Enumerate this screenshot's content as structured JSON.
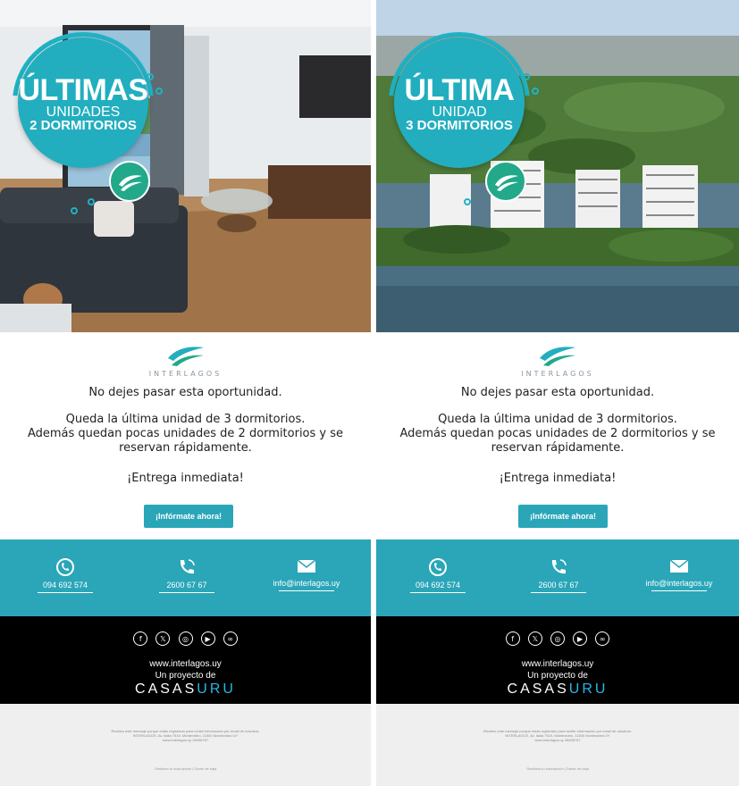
{
  "colors": {
    "teal": "#2aa6b8",
    "badge_teal": "#22aebf",
    "logo_green": "#21a98a",
    "dark_footer": "#000000",
    "legal_bg": "#efefef",
    "brand_blue": "#29b7e6"
  },
  "emails": [
    {
      "badge": {
        "line1": "ÚLTIMAS",
        "line2": "UNIDADES",
        "line3": "2 DORMITORIOS"
      },
      "brand_name": "INTERLAGOS",
      "headline": "No dejes pasar esta oportunidad.",
      "body_line1": "Queda la última unidad de 3 dormitorios.",
      "body_line2": "Además quedan pocas unidades de 2 dormitorios y se",
      "body_line3": "reservan rápidamente.",
      "delivery": "¡Entrega inmediata!",
      "cta_label": "¡Infórmate ahora!",
      "contact": {
        "whatsapp": {
          "icon": "whatsapp-icon",
          "label": "094 692 574"
        },
        "phone": {
          "icon": "phone-icon",
          "label": "2600 67 67"
        },
        "email": {
          "icon": "mail-icon",
          "label": "info@interlagos.uy"
        }
      },
      "socials": [
        {
          "icon": "facebook-icon",
          "glyph": "f"
        },
        {
          "icon": "x-icon",
          "glyph": "𝕏"
        },
        {
          "icon": "instagram-icon",
          "glyph": "◎"
        },
        {
          "icon": "youtube-icon",
          "glyph": "▶"
        },
        {
          "icon": "link-icon",
          "glyph": "∞"
        }
      ],
      "website": "www.interlagos.uy",
      "project_of": "Un proyecto de",
      "casas_left": "CASAS",
      "casas_right": "URU",
      "legal": {
        "line1": "Recibes este mensaje porque estás registrado para recibir información por email de nosotros.",
        "line2": "INTERLAGOS, Av. Italia 7519, Montevideo, 11500 Montevideo UY",
        "line3": "www.interlagos.uy 26006767",
        "links": "Gestiona tu suscripción  |  Darse de baja"
      }
    },
    {
      "badge": {
        "line1": "ÚLTIMA",
        "line2": "UNIDAD",
        "line3": "3 DORMITORIOS"
      },
      "brand_name": "INTERLAGOS",
      "headline": "No dejes pasar esta oportunidad.",
      "body_line1": "Queda la última unidad de 3 dormitorios.",
      "body_line2": "Además quedan pocas unidades de 2 dormitorios y se",
      "body_line3": "reservan rápidamente.",
      "delivery": "¡Entrega inmediata!",
      "cta_label": "¡Infórmate ahora!",
      "contact": {
        "whatsapp": {
          "icon": "whatsapp-icon",
          "label": "094 692 574"
        },
        "phone": {
          "icon": "phone-icon",
          "label": "2600 67 67"
        },
        "email": {
          "icon": "mail-icon",
          "label": "info@interlagos.uy"
        }
      },
      "socials": [
        {
          "icon": "facebook-icon",
          "glyph": "f"
        },
        {
          "icon": "x-icon",
          "glyph": "𝕏"
        },
        {
          "icon": "instagram-icon",
          "glyph": "◎"
        },
        {
          "icon": "youtube-icon",
          "glyph": "▶"
        },
        {
          "icon": "link-icon",
          "glyph": "∞"
        }
      ],
      "website": "www.interlagos.uy",
      "project_of": "Un proyecto de",
      "casas_left": "CASAS",
      "casas_right": "URU",
      "legal": {
        "line1": "Recibes este mensaje porque estás registrado para recibir información por email de nosotros.",
        "line2": "INTERLAGOS, Av. Italia 7519, Montevideo, 11500 Montevideo UY",
        "line3": "www.interlagos.uy 26006767",
        "links": "Gestiona tu suscripción  |  Darse de baja"
      }
    }
  ]
}
